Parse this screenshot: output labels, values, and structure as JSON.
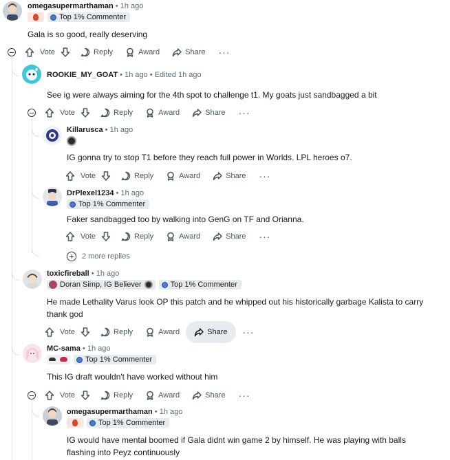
{
  "labels": {
    "vote": "Vote",
    "reply": "Reply",
    "award": "Award",
    "share": "Share",
    "more": "···",
    "dot": "•"
  },
  "comments": [
    {
      "username": "omegasupermarthaman",
      "time": "1h ago",
      "flair": "Top 1% Commenter",
      "body": "Gala is so good, really deserving"
    },
    {
      "username": "ROOKIE_MY_GOAT",
      "time": "1h ago",
      "edited": "Edited 1h ago",
      "body": "See ig were always aiming for the 4th spot to challenge t1. My goats just sandbagged a bit"
    },
    {
      "username": "Killarusca",
      "time": "1h ago",
      "body": "IG gonna try to stop T1 before they reach full power in Worlds. LPL heroes o7."
    },
    {
      "username": "DrPlexel1234",
      "time": "1h ago",
      "flair": "Top 1% Commenter",
      "body": "Faker sandbagged too by walking into GenG on TF and Orianna."
    },
    {
      "username": "toxicfireball",
      "time": "1h ago",
      "flair_user": "Doran Simp, IG Believer",
      "flair": "Top 1% Commenter",
      "body_line1": "He made Lethality Varus look OP this patch and he whipped out his historically garbage Kalista to carry",
      "body_line2": "thank god"
    },
    {
      "username": "MC-sama",
      "time": "1h ago",
      "flair": "Top 1% Commenter",
      "body": "This IG draft wouldn't have worked without him"
    },
    {
      "username": "omegasupermarthaman",
      "time": "1h ago",
      "flair": "Top 1% Commenter",
      "body_line1": "IG would have mental boomed if Gala didnt win game 2 by himself. He was playing with balls",
      "body_line2": "flashing into Peyz continuously"
    }
  ],
  "more_replies": "2 more replies"
}
